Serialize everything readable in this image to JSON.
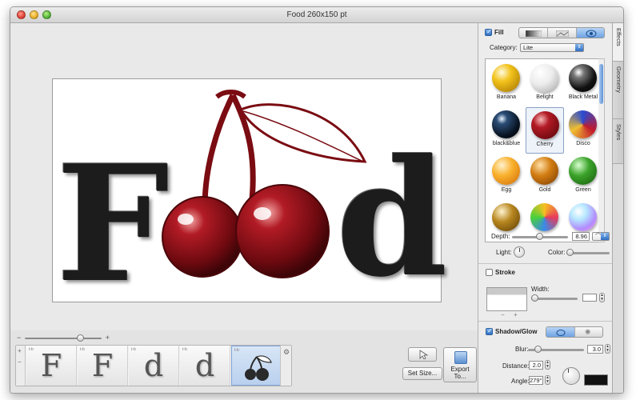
{
  "window": {
    "title": "Food 260x150 pt"
  },
  "canvas": {
    "letters": [
      "F",
      "d"
    ]
  },
  "bottom": {
    "zoom_minus": "−",
    "zoom_plus": "+",
    "zoom_level": 0.72,
    "strip_add": "+",
    "strip_remove": "−",
    "thumbs": [
      {
        "label": "t-b",
        "glyph": "F"
      },
      {
        "label": "t-b",
        "glyph": "F"
      },
      {
        "label": "t-b",
        "glyph": "d"
      },
      {
        "label": "t-b",
        "glyph": "d"
      },
      {
        "label": "t-b",
        "glyph": "🍒",
        "selected": true
      }
    ],
    "gear": "⚙",
    "set_size_label": "Set Size...",
    "export_label": "Export To..."
  },
  "sidebar": {
    "tabs": [
      "Effects",
      "Geometry",
      "Styles"
    ],
    "fill": {
      "label": "Fill",
      "checked": true,
      "category_label": "Category:",
      "category_value": "Lite",
      "styles": [
        {
          "name": "Banana",
          "color": "#f2c21a"
        },
        {
          "name": "Belight",
          "color": "#e9e9e9"
        },
        {
          "name": "Black Metal",
          "color": "#1a1a1a"
        },
        {
          "name": "black&blue",
          "color": "#0b1a2e"
        },
        {
          "name": "Cherry",
          "color": "#8c0d16",
          "selected": true
        },
        {
          "name": "Disco",
          "color": "#b0233a"
        },
        {
          "name": "Egg",
          "color": "#f59a1a"
        },
        {
          "name": "Gold",
          "color": "#d27d12"
        },
        {
          "name": "Green",
          "color": "#3ba32a"
        },
        {
          "name": "",
          "color": "#b7861e"
        },
        {
          "name": "",
          "color": "#f08c2a"
        },
        {
          "name": "",
          "color": "#9ad0ff"
        }
      ],
      "depth_label": "Depth:",
      "depth_value": "8.96",
      "light_label": "Light:",
      "color_label": "Color:"
    },
    "stroke": {
      "label": "Stroke",
      "checked": false,
      "width_label": "Width:",
      "remove": "−",
      "add": "+"
    },
    "shadow": {
      "label": "Shadow/Glow",
      "checked": true,
      "blur_label": "Blur:",
      "blur_value": "3.0",
      "distance_label": "Distance:",
      "distance_value": "2.0",
      "angle_label": "Angle:",
      "angle_value": "279°"
    }
  },
  "colors": {
    "cherry": "#8c0d16",
    "accent": "#2f6fc4"
  }
}
